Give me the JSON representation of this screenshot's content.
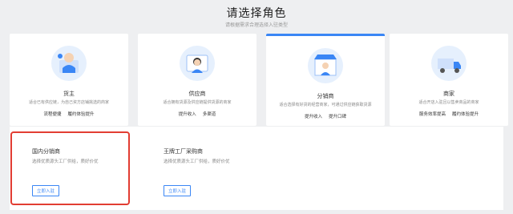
{
  "header": {
    "title": "请选择角色",
    "subtitle": "请根据需求合理选择入驻类型"
  },
  "roles": [
    {
      "name": "货主",
      "desc": "适合已有供应链，为自己资方店铺挑选的商家",
      "tags": [
        "流程便捷",
        "履约体验提升"
      ],
      "icon": "cargo-owner-illustration"
    },
    {
      "name": "供应商",
      "desc": "适合拥有货源及供应链提供货源的商家",
      "tags": [
        "提升收入",
        "多渠道"
      ],
      "icon": "supplier-illustration"
    },
    {
      "name": "分销商",
      "desc": "适合选择有好货的经营商家，可通过供应链获取货源",
      "tags": [
        "提升收入",
        "提升口碑"
      ],
      "icon": "distributor-storefront-illustration"
    },
    {
      "name": "商家",
      "desc": "适合开店入驻且以售卖商品的商家",
      "tags": [
        "服务效率提高",
        "履约体验提升"
      ],
      "icon": "merchant-truck-illustration"
    }
  ],
  "sub_options": [
    {
      "title": "国内分销商",
      "desc": "选择优质源头工厂供给，质好价优",
      "button": "立即入驻"
    },
    {
      "title": "王牌工厂采购商",
      "desc": "选择优质源头工厂供给，质好价优",
      "button": "立即入驻"
    }
  ],
  "colors": {
    "accent": "#3a86f5",
    "highlight": "#e23d33",
    "background": "#eeeff1"
  }
}
